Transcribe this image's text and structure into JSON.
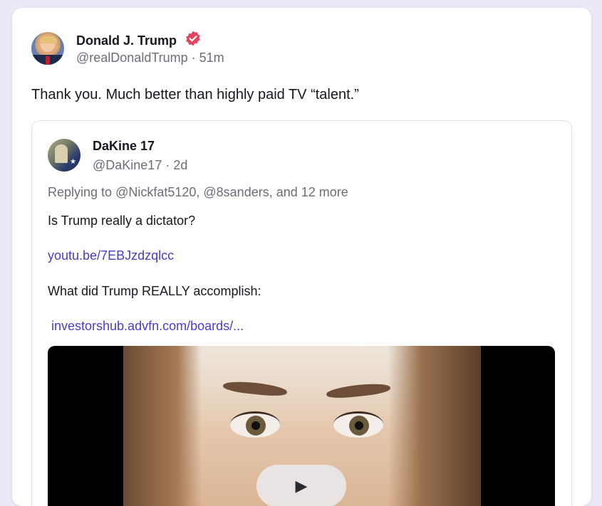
{
  "post": {
    "author_name": "Donald J. Trump",
    "author_handle": "@realDonaldTrump · 51m",
    "text": "Thank you. Much better than highly paid TV “talent.”"
  },
  "quote": {
    "author_name": "DaKine 17",
    "author_handle": "@DaKine17 · 2d",
    "reply_prefix": "Replying to ",
    "reply_mentions": "@Nickfat5120, @8sanders",
    "reply_suffix": ", and 12 more",
    "line1": "Is Trump really a dictator?",
    "link1": "youtu.be/7EBJzdzqlcc",
    "line2": "What did Trump REALLY accomplish:",
    "link2": " investorshub.advfn.com/boards/..."
  },
  "icons": {
    "verified": "verified-badge-icon",
    "play": "play-icon"
  },
  "colors": {
    "link": "#4b3cc8",
    "verified": "#e2445c",
    "page_bg": "#e9eaf6"
  }
}
